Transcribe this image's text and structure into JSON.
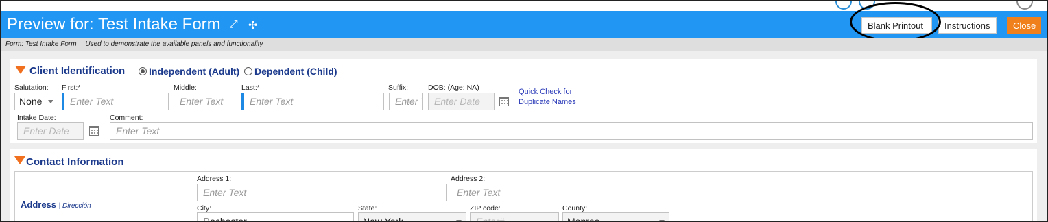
{
  "header": {
    "title": "Preview for: Test Intake Form",
    "expand_icon": "expand-icon",
    "collapse_icon": "collapse-icon",
    "blank_printout_label": "Blank Printout",
    "instructions_label": "Instructions",
    "close_label": "Close"
  },
  "subbar": {
    "form_name": "Form: Test Intake Form",
    "description": "Used to demonstrate the available panels and functionality"
  },
  "client_identification": {
    "title": "Client Identification",
    "radio_options": [
      {
        "label": "Independent (Adult)",
        "selected": true
      },
      {
        "label": "Dependent (Child)",
        "selected": false
      }
    ],
    "fields": {
      "salutation": {
        "label": "Salutation:",
        "value": "None"
      },
      "first": {
        "label": "First:*",
        "placeholder": "Enter Text"
      },
      "middle": {
        "label": "Middle:",
        "placeholder": "Enter Text"
      },
      "last": {
        "label": "Last:*",
        "placeholder": "Enter Text"
      },
      "suffix": {
        "label": "Suffix:",
        "placeholder": "Enter Text"
      },
      "dob": {
        "label": "DOB: (Age: NA)",
        "placeholder": "Enter Date"
      },
      "intake_date": {
        "label": "Intake Date:",
        "placeholder": "Enter Date"
      },
      "comment": {
        "label": "Comment:",
        "placeholder": "Enter Text"
      }
    },
    "quick_check_line1": "Quick Check for",
    "quick_check_line2": "Duplicate Names"
  },
  "contact_information": {
    "title": "Contact Information",
    "address_label": "Address",
    "address_alt": "Dirección",
    "fields": {
      "address1": {
        "label": "Address 1:",
        "placeholder": "Enter Text"
      },
      "address2": {
        "label": "Address 2:",
        "placeholder": "Enter Text"
      },
      "city": {
        "label": "City:",
        "value": "Rochester"
      },
      "state": {
        "label": "State:",
        "value": "New York"
      },
      "zip": {
        "label": "ZIP code:",
        "placeholder": "Enter#"
      },
      "county": {
        "label": "County:",
        "value": "Monroe"
      }
    }
  },
  "colors": {
    "header_bg": "#2196f3",
    "close_button": "#f0801c",
    "section_title": "#1c3a8c",
    "required_marker": "#1e88e5",
    "collapse_triangle": "#f07020"
  }
}
